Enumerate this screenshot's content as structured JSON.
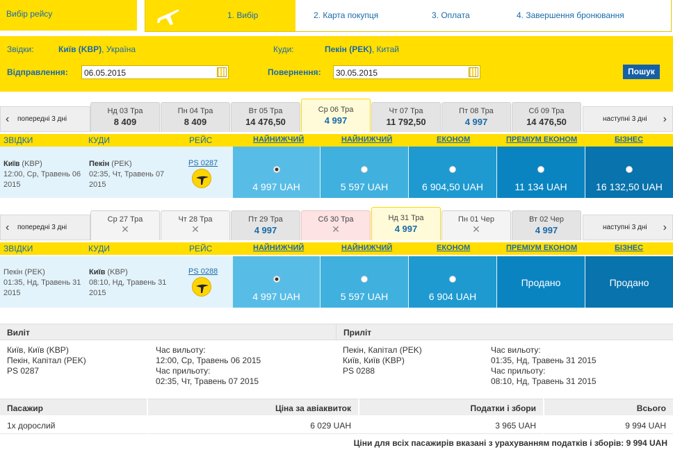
{
  "header": {
    "select_flight": "Вибір рейсу",
    "steps": [
      "1. Вибір",
      "2. Карта покупця",
      "3. Оплата",
      "4. Завершення бронювання"
    ]
  },
  "search": {
    "from_label": "Звідки:",
    "from_city": "Київ (KBP)",
    "from_country": ", Україна",
    "to_label": "Куди:",
    "to_city": "Пекін (PEK)",
    "to_country": ", Китай",
    "depart_label": "Відправлення:",
    "depart_value": "06.05.2015",
    "return_label": "Повернення:",
    "return_value": "30.05.2015",
    "search_button": "Пошук"
  },
  "outbound": {
    "prev": "попередні 3 дні",
    "next": "наступні 3 дні",
    "dates": [
      {
        "day": "Нд 03 Тра",
        "price": "8 409"
      },
      {
        "day": "Пн 04 Тра",
        "price": "8 409"
      },
      {
        "day": "Вт 05 Тра",
        "price": "14 476,50"
      },
      {
        "day": "Ср 06 Тра",
        "price": "4 997"
      },
      {
        "day": "Чт 07 Тра",
        "price": "11 792,50"
      },
      {
        "day": "Пт 08 Тра",
        "price": "4 997"
      },
      {
        "day": "Сб 09 Тра",
        "price": "14 476,50"
      }
    ],
    "cols": {
      "from": "ЗВІДКИ",
      "to": "КУДИ",
      "flight": "РЕЙС",
      "f1": "НАЙНИЖЧИЙ",
      "f2": "НАЙНИЖЧИЙ",
      "f3": "ЕКОНОМ",
      "f4": "ПРЕМІУМ ЕКОНОМ",
      "f5": "БІЗНЕС"
    },
    "from_city": "Київ",
    "from_code": " (KBP)",
    "from_time": "12:00, Ср, Травень 06",
    "from_year": "2015",
    "to_city": "Пекін",
    "to_code": " (PEK)",
    "to_time": "02:35, Чт, Травень 07",
    "to_year": "2015",
    "flight_no": "PS 0287",
    "fares": [
      "4 997 UAH",
      "5 597 UAH",
      "6 904,50 UAH",
      "11 134 UAH",
      "16 132,50 UAH"
    ]
  },
  "inbound": {
    "prev": "попередні 3 дні",
    "next": "наступні 3 дні",
    "dates": [
      {
        "day": "Ср 27 Тра",
        "price": "✕"
      },
      {
        "day": "Чт 28 Тра",
        "price": "✕"
      },
      {
        "day": "Пт 29 Тра",
        "price": "4 997"
      },
      {
        "day": "Сб 30 Тра",
        "price": "✕"
      },
      {
        "day": "Нд 31 Тра",
        "price": "4 997"
      },
      {
        "day": "Пн 01 Чер",
        "price": "✕"
      },
      {
        "day": "Вт 02 Чер",
        "price": "4 997"
      }
    ],
    "cols": {
      "from": "ЗВІДКИ",
      "to": "КУДИ",
      "flight": "РЕЙС",
      "f1": "НАЙНИЖЧИЙ",
      "f2": "НАЙНИЖЧИЙ",
      "f3": "ЕКОНОМ",
      "f4": "ПРЕМІУМ ЕКОНОМ",
      "f5": "БІЗНЕС"
    },
    "from_city": "Пекін",
    "from_code": " (PEK)",
    "from_time": "01:35, Нд, Травень 31",
    "from_year": "2015",
    "to_city": "Київ",
    "to_code": " (KBP)",
    "to_time": "08:10, Нд, Травень 31",
    "to_year": "2015",
    "flight_no": "PS 0288",
    "fares": [
      "4 997 UAH",
      "5 597 UAH",
      "6 904 UAH",
      "Продано",
      "Продано"
    ]
  },
  "summary": {
    "departure_title": "Виліт",
    "arrival_title": "Приліт",
    "dep_lines": [
      "Київ, Київ (KBP)",
      "Пекін, Капітал (PEK)",
      "PS 0287"
    ],
    "dep_times": [
      "Час вильоту:",
      "12:00, Ср, Травень 06 2015",
      "Час прильоту:",
      "02:35, Чт, Травень 07 2015"
    ],
    "arr_lines": [
      "Пекін, Капітал (PEK)",
      "Київ, Київ (KBP)",
      "PS 0288"
    ],
    "arr_times": [
      "Час вильоту:",
      "01:35, Нд, Травень 31 2015",
      "Час прильоту:",
      "08:10, Нд, Травень 31 2015"
    ]
  },
  "pricing": {
    "h_passenger": "Пасажир",
    "h_ticket": "Ціна за авіаквиток",
    "h_taxes": "Податки і збори",
    "h_total": "Всього",
    "passenger": "1x дорослий",
    "ticket": "6 029 UAH",
    "taxes": "3 965 UAH",
    "total": "9 994 UAH",
    "note": "Ціни для всіх пасажирів вказані з урахуванням податків і зборів: 9 994 UAH"
  }
}
